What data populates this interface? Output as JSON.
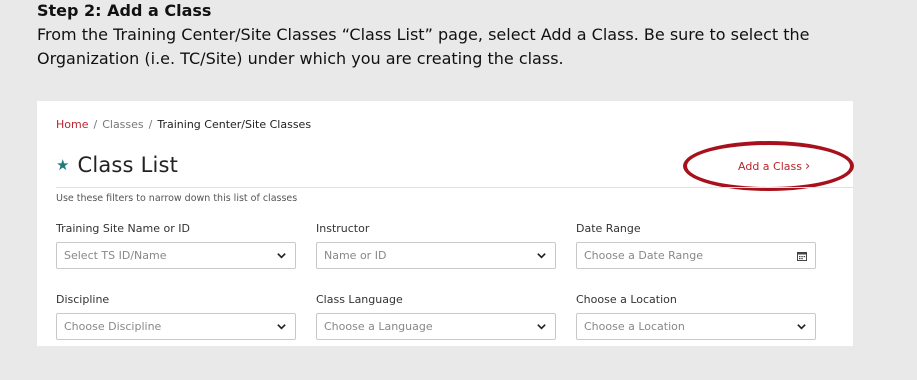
{
  "header": {
    "step_title": "Step 2: Add a Class",
    "description": "From the Training Center/Site Classes “Class List” page, select Add a Class. Be sure to select the Organization (i.e. TC/Site) under which you are creating the class."
  },
  "breadcrumb": {
    "home": "Home",
    "sep1": "/",
    "classes": "Classes",
    "sep2": "/",
    "current": "Training Center/Site Classes"
  },
  "page": {
    "title": "Class List",
    "add_class_label": "Add a Class",
    "add_class_chevron": "›",
    "hint": "Use these filters to narrow down this list of classes"
  },
  "filters": {
    "training_site": {
      "label": "Training Site Name or ID",
      "placeholder": "Select TS ID/Name"
    },
    "instructor": {
      "label": "Instructor",
      "placeholder": "Name or ID"
    },
    "date_range": {
      "label": "Date Range",
      "placeholder": "Choose a Date Range"
    },
    "discipline": {
      "label": "Discipline",
      "placeholder": "Choose Discipline"
    },
    "class_language": {
      "label": "Class Language",
      "placeholder": "Choose a Language"
    },
    "location": {
      "label": "Choose a Location",
      "placeholder": "Choose a Location"
    }
  },
  "colors": {
    "accent_red": "#b9262d",
    "highlight_circle": "#a8111c",
    "star_teal": "#1f7a7a"
  }
}
